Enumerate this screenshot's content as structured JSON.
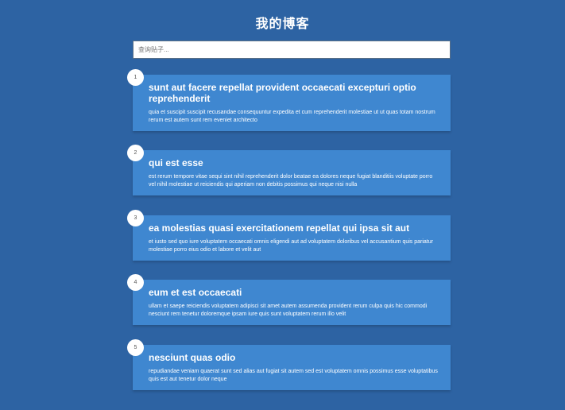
{
  "header": {
    "title": "我的博客"
  },
  "search": {
    "placeholder": "查询贴子..."
  },
  "posts": [
    {
      "number": "1",
      "title": "sunt aut facere repellat provident occaecati excepturi optio reprehenderit",
      "body": "quia et suscipit suscipit recusandae consequuntur expedita et cum reprehenderit molestiae ut ut quas totam nostrum rerum est autem sunt rem eveniet architecto"
    },
    {
      "number": "2",
      "title": "qui est esse",
      "body": "est rerum tempore vitae sequi sint nihil reprehenderit dolor beatae ea dolores neque fugiat blanditiis voluptate porro vel nihil molestiae ut reiciendis qui aperiam non debitis possimus qui neque nisi nulla"
    },
    {
      "number": "3",
      "title": "ea molestias quasi exercitationem repellat qui ipsa sit aut",
      "body": "et iusto sed quo iure voluptatem occaecati omnis eligendi aut ad voluptatem doloribus vel accusantium quis pariatur molestiae porro eius odio et labore et velit aut"
    },
    {
      "number": "4",
      "title": "eum et est occaecati",
      "body": "ullam et saepe reiciendis voluptatem adipisci sit amet autem assumenda provident rerum culpa quis hic commodi nesciunt rem tenetur doloremque ipsam iure quis sunt voluptatem rerum illo velit"
    },
    {
      "number": "5",
      "title": "nesciunt quas odio",
      "body": "repudiandae veniam quaerat sunt sed alias aut fugiat sit autem sed est voluptatem omnis possimus esse voluptatibus quis est aut tenetur dolor neque"
    }
  ],
  "colors": {
    "background": "#2d63a3",
    "card": "#3f87d0",
    "text": "#ffffff"
  }
}
